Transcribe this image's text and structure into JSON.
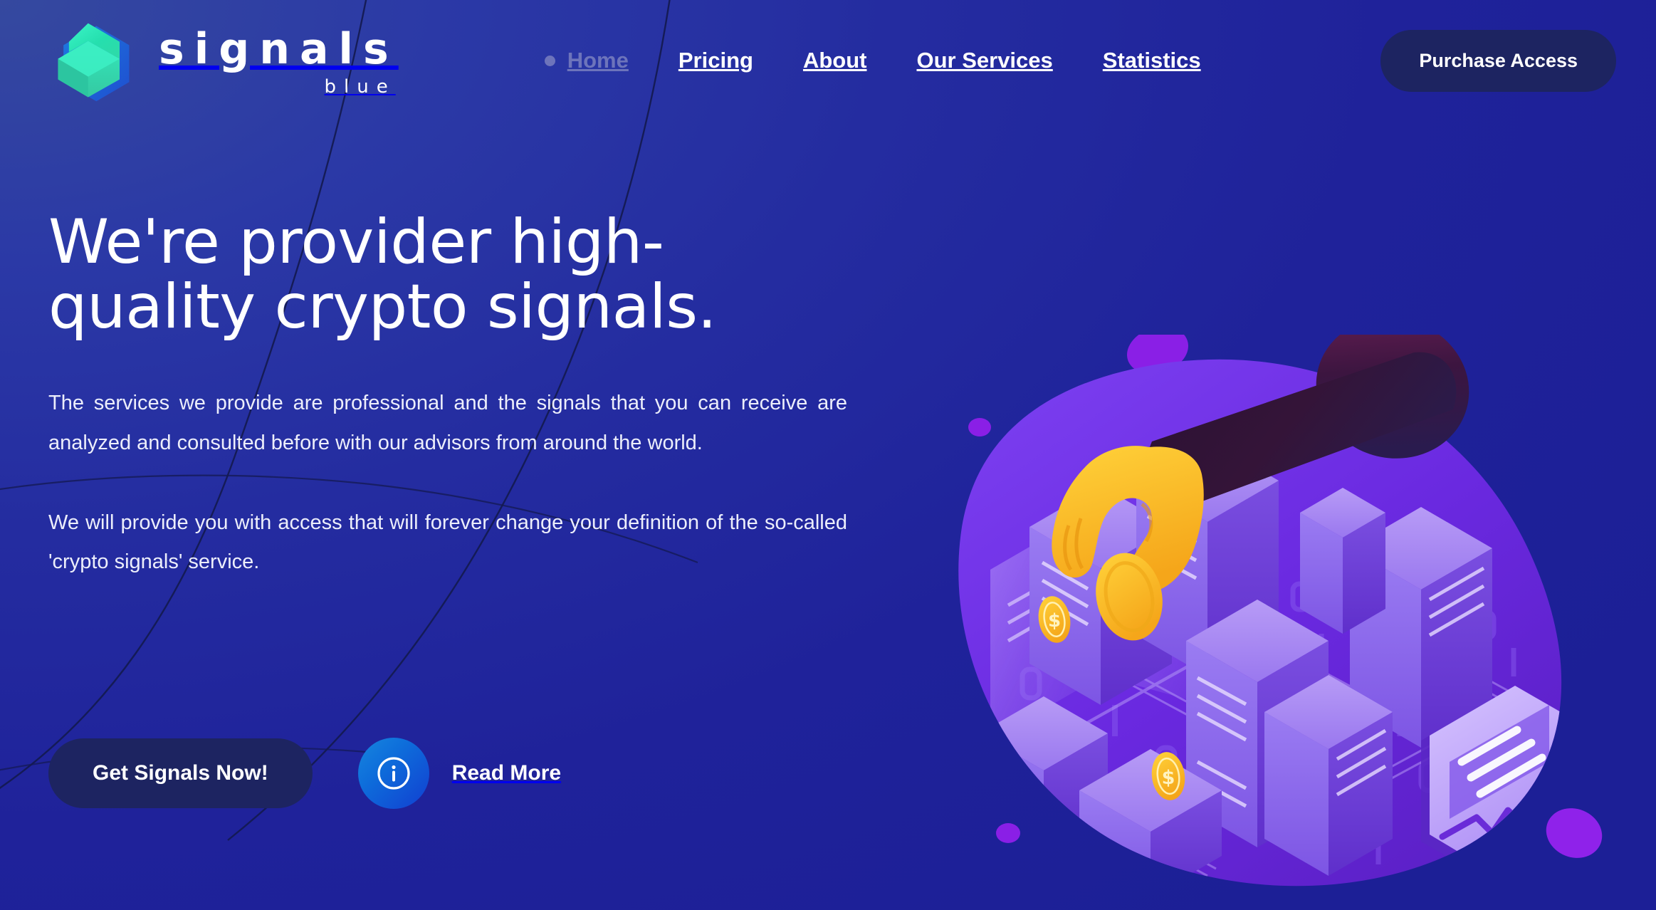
{
  "brand": {
    "name": "signals",
    "sub": "blue",
    "logo_icon": "hexagon-cube-logo",
    "accent_teal": "#2ee6b0",
    "accent_green": "#33f0c0",
    "accent_blue": "#1f5bd6"
  },
  "nav": {
    "items": [
      {
        "label": "Home",
        "active": true,
        "icon": "bullet-dot"
      },
      {
        "label": "Pricing",
        "active": false
      },
      {
        "label": "About",
        "active": false
      },
      {
        "label": "Our Services",
        "active": false
      },
      {
        "label": "Statistics",
        "active": false
      }
    ],
    "cta_label": "Purchase Access",
    "active_color": "#6d74bb",
    "inactive_color": "#ffffff"
  },
  "hero": {
    "title": "We're provider high-quality crypto signals.",
    "paragraph_1": "The services we provide are professional and the signals that you can receive are analyzed and consulted before with our advisors from around the world.",
    "paragraph_2": "We will provide you with access that will forever change your definition of the so-called 'crypto signals' service.",
    "primary_cta": "Get Signals Now!",
    "secondary_cta": "Read More",
    "secondary_icon": "info-circle-icon",
    "illustration": "isometric-crypto-city-hand-dropping-coins"
  },
  "theme": {
    "background_top_left": "#35499f",
    "background_bottom_right": "#1c1f96",
    "button_navy": "#1d2461",
    "info_icon_gradient_from": "#1786de",
    "info_icon_gradient_to": "#113fd1",
    "illustration_blob_purple": "#8a1fe6",
    "illustration_base_purple": "#6a2bd8"
  }
}
